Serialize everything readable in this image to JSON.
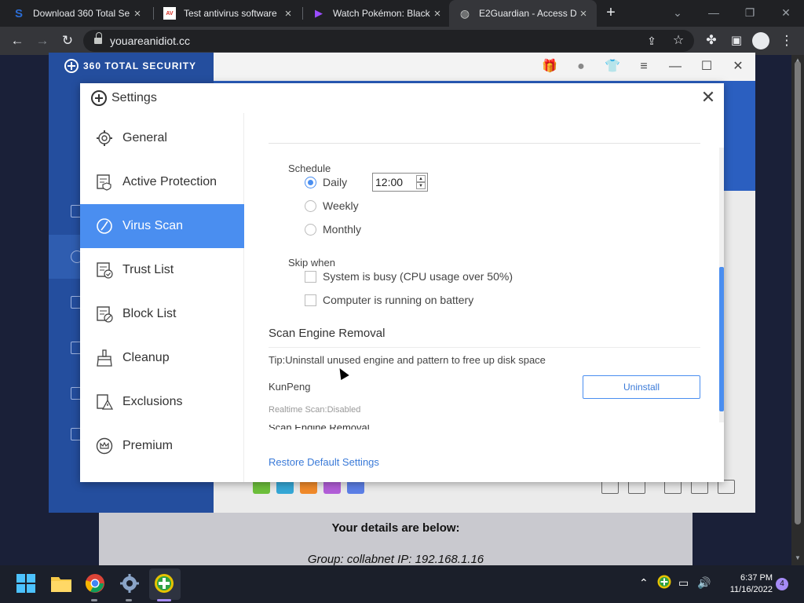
{
  "browser": {
    "tabs": [
      {
        "title": "Download 360 Total Se",
        "favicon": "360-logo-icon",
        "color": "#2b6cd4"
      },
      {
        "title": "Test antivirus software",
        "favicon": "av-test-icon",
        "color": "#d93025"
      },
      {
        "title": "Watch Pokémon: Black",
        "favicon": "play-icon",
        "color": "#9b4dff"
      },
      {
        "title": "E2Guardian - Access D",
        "favicon": "globe-icon",
        "color": "#c4c7c5"
      }
    ],
    "url": "youareanidiot.cc"
  },
  "background_page": {
    "details_heading": "Your details are below:",
    "details_line": "Group: collabnet   IP: 192.168.1.16"
  },
  "app": {
    "brand": "360 TOTAL SECURITY"
  },
  "settings": {
    "title": "Settings",
    "nav": [
      {
        "label": "General",
        "icon": "gear-icon"
      },
      {
        "label": "Active Protection",
        "icon": "shield-list-icon"
      },
      {
        "label": "Virus Scan",
        "icon": "scan-icon",
        "active": true
      },
      {
        "label": "Trust List",
        "icon": "trust-list-icon"
      },
      {
        "label": "Block List",
        "icon": "block-list-icon"
      },
      {
        "label": "Cleanup",
        "icon": "broom-icon"
      },
      {
        "label": "Exclusions",
        "icon": "warning-icon"
      },
      {
        "label": "Premium",
        "icon": "crown-icon"
      }
    ],
    "schedule": {
      "label": "Schedule",
      "options": [
        "Daily",
        "Weekly",
        "Monthly"
      ],
      "selected": "Daily",
      "time": "12:00"
    },
    "skip_when": {
      "label": "Skip when",
      "options": [
        "System is busy (CPU usage over 50%)",
        "Computer is running on battery"
      ]
    },
    "engine_removal": {
      "heading": "Scan Engine Removal",
      "tip": "Tip:Uninstall unused engine and pattern to free up disk space",
      "engine_name": "KunPeng",
      "uninstall_label": "Uninstall",
      "realtime_status": "Realtime Scan:Disabled",
      "cut_text": "Scan Engine Removal"
    },
    "restore_label": "Restore Default Settings",
    "accent": "#4a8ef0"
  },
  "taskbar": {
    "time": "6:37 PM",
    "date": "11/16/2022",
    "notifications": "4"
  }
}
